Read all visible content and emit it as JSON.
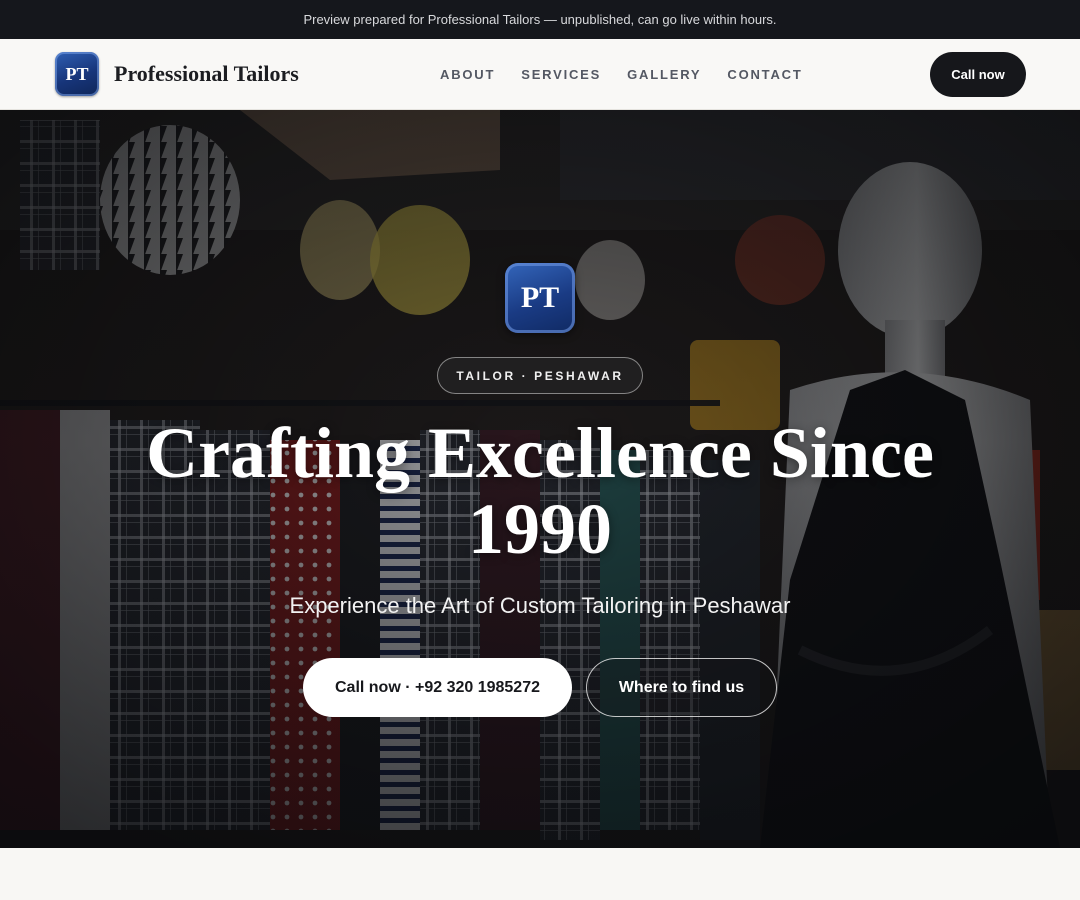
{
  "preview_banner": "Preview prepared for Professional Tailors — unpublished, can go live within hours.",
  "header": {
    "logo_text": "PT",
    "brand_name": "Professional Tailors",
    "nav": [
      "ABOUT",
      "SERVICES",
      "GALLERY",
      "CONTACT"
    ],
    "call_button": "Call now"
  },
  "hero": {
    "logo_text": "PT",
    "tagline": "TAILOR · PESHAWAR",
    "headline": "Crafting Excellence Since 1990",
    "subheadline": "Experience the Art of Custom Tailoring in Peshawar",
    "primary_cta": "Call now · +92 320 1985272",
    "secondary_cta": "Where to find us"
  },
  "colors": {
    "banner_bg": "#15171c",
    "header_bg": "#f9f8f6",
    "dark_button": "#16171b",
    "logo_blue": "#1a3b84"
  }
}
